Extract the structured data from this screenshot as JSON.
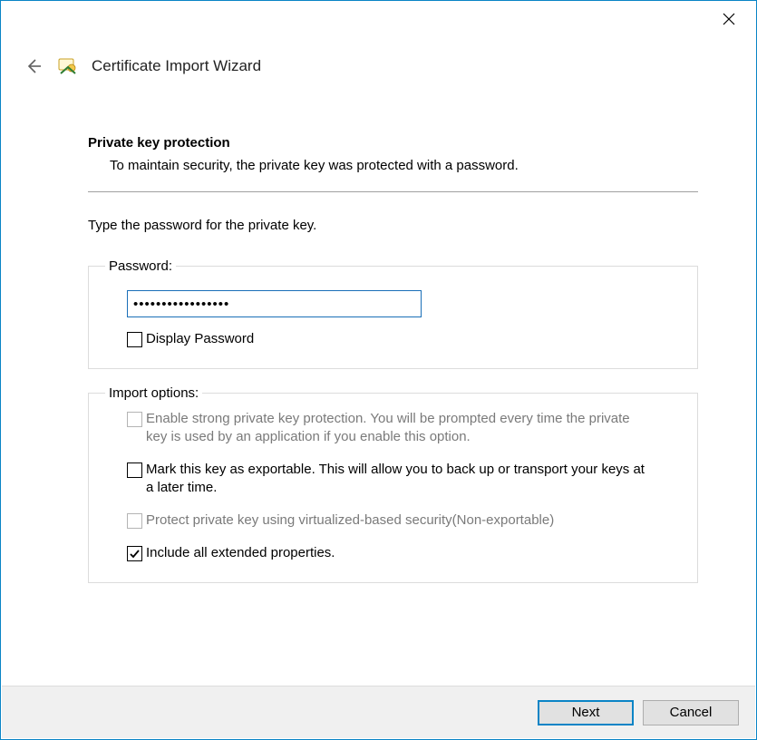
{
  "header": {
    "title": "Certificate Import Wizard"
  },
  "section": {
    "title": "Private key protection",
    "description": "To maintain security, the private key was protected with a password."
  },
  "prompt": "Type the password for the private key.",
  "password_group": {
    "legend": "Password:",
    "value": "•••••••••••••••••",
    "display_password_label": "Display Password",
    "display_password_checked": false
  },
  "import_options": {
    "legend": "Import options:",
    "items": [
      {
        "label": "Enable strong private key protection. You will be prompted every time the private key is used by an application if you enable this option.",
        "checked": false,
        "disabled": true
      },
      {
        "label": "Mark this key as exportable. This will allow you to back up or transport your keys at a later time.",
        "checked": false,
        "disabled": false
      },
      {
        "label": "Protect private key using virtualized-based security(Non-exportable)",
        "checked": false,
        "disabled": true
      },
      {
        "label": "Include all extended properties.",
        "checked": true,
        "disabled": false
      }
    ]
  },
  "footer": {
    "next_label": "Next",
    "cancel_label": "Cancel"
  }
}
